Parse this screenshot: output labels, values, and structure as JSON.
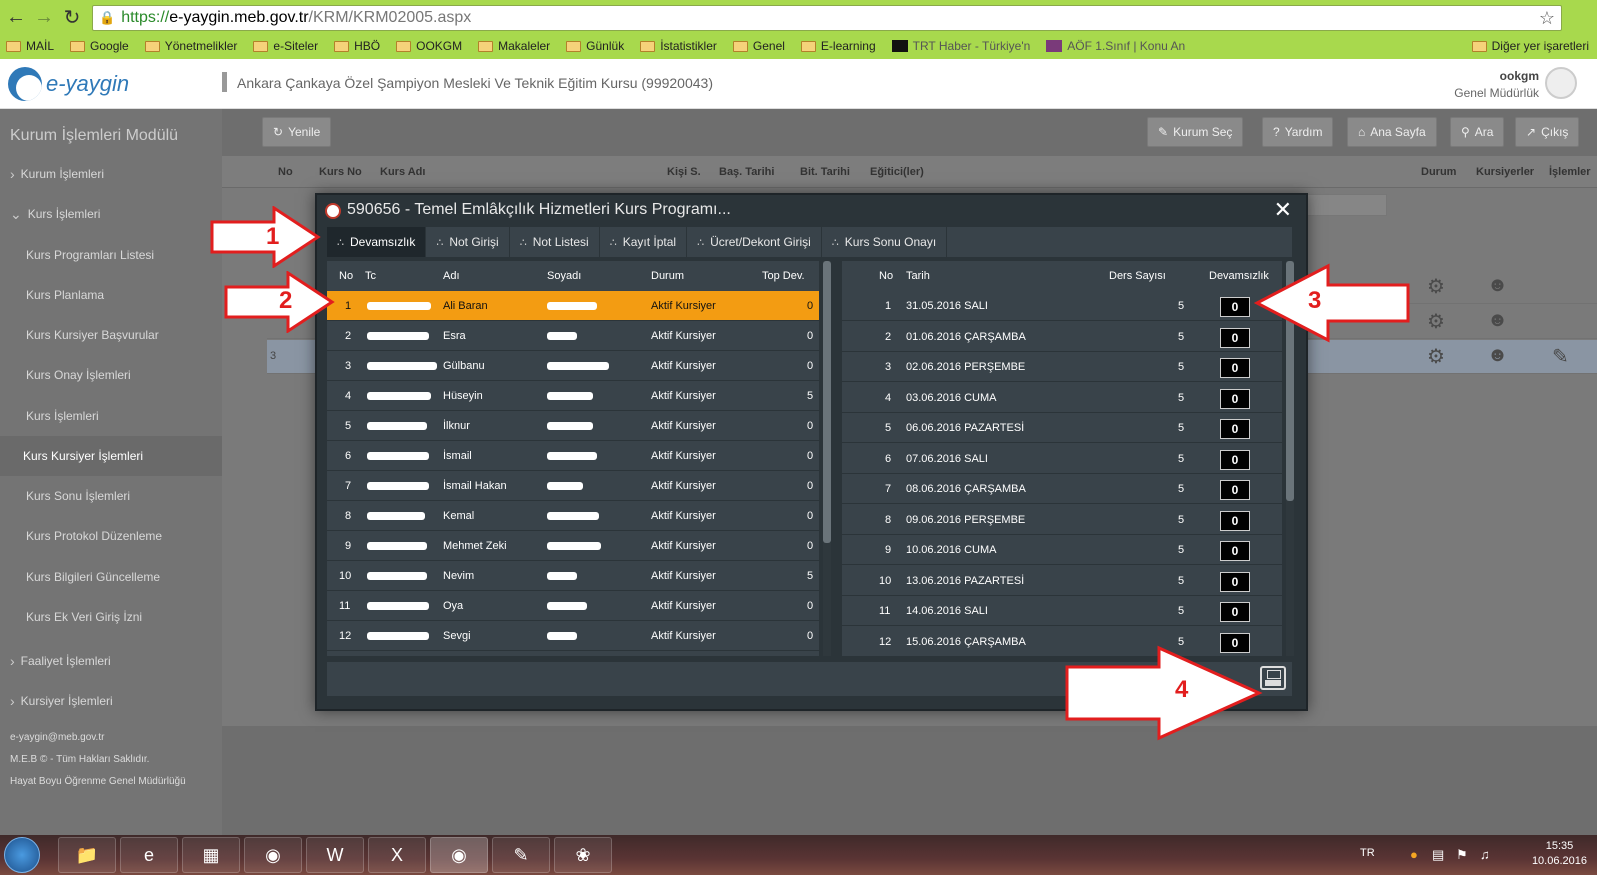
{
  "browser": {
    "url_scheme": "https://",
    "url_host": "e-yaygin.meb.gov.tr",
    "url_path": "/KRM/KRM02005.aspx",
    "bookmarks": [
      "MAİL",
      "Google",
      "Yönetmelikler",
      "e-Siteler",
      "HBÖ",
      "OOKGM",
      "Makaleler",
      "Günlük",
      "İstatistikler",
      "Genel",
      "E-learning"
    ],
    "bookmark_trt": "TRT Haber - Türkiye'n",
    "bookmark_aof": "AÖF 1.Sınıf | Konu An",
    "bookmark_other": "Diğer yer işaretleri"
  },
  "header": {
    "logo": "e-yaygin",
    "institution": "Ankara Çankaya Özel Şampiyon Mesleki Ve Teknik Eğitim Kursu (99920043)",
    "user_name": "ookgm",
    "user_dept": "Genel Müdürlük"
  },
  "sidebar": {
    "title": "Kurum İşlemleri Modülü",
    "items": [
      {
        "label": "Kurum İşlemleri",
        "kind": "cat"
      },
      {
        "label": "Kurs İşlemleri",
        "kind": "cat-open"
      },
      {
        "label": "Kurs Programları Listesi",
        "kind": "sub"
      },
      {
        "label": "Kurs Planlama",
        "kind": "sub"
      },
      {
        "label": "Kurs Kursiyer Başvurular",
        "kind": "sub"
      },
      {
        "label": "Kurs Onay İşlemleri",
        "kind": "sub"
      },
      {
        "label": "Kurs İşlemleri",
        "kind": "sub"
      },
      {
        "label": "Kurs Kursiyer İşlemleri",
        "kind": "active"
      },
      {
        "label": "Kurs Sonu İşlemleri",
        "kind": "sub"
      },
      {
        "label": "Kurs Protokol Düzenleme",
        "kind": "sub"
      },
      {
        "label": "Kurs Bilgileri Güncelleme",
        "kind": "sub"
      },
      {
        "label": "Kurs Ek Veri Giriş İzni",
        "kind": "sub"
      },
      {
        "label": "Faaliyet İşlemleri",
        "kind": "cat"
      },
      {
        "label": "Kursiyer İşlemleri",
        "kind": "cat"
      }
    ],
    "footer": [
      "e-yaygin@meb.gov.tr",
      "M.E.B © - Tüm Hakları Saklıdır.",
      "Hayat Boyu Öğrenme Genel Müdürlüğü"
    ]
  },
  "toolbar": {
    "refresh": "Yenile",
    "select_inst": "Kurum Seç",
    "help": "Yardım",
    "home": "Ana Sayfa",
    "search": "Ara",
    "logout": "Çıkış"
  },
  "grid": {
    "headers": [
      "No",
      "Kurs No",
      "Kurs Adı",
      "Kişi S.",
      "Baş. Tarihi",
      "Bit. Tarihi",
      "Eğitici(ler)",
      "Durum",
      "Kursiyerler",
      "İşlemler"
    ],
    "row3_no": "3"
  },
  "modal": {
    "title": "590656 - Temel Emlâkçılık Hizmetleri Kurs Programı...",
    "tabs": [
      "Devamsızlık",
      "Not Girişi",
      "Not Listesi",
      "Kayıt İptal",
      "Ücret/Dekont Girişi",
      "Kurs Sonu Onayı"
    ],
    "left_headers": [
      "No",
      "Tc",
      "Adı",
      "Soyadı",
      "Durum",
      "Top Dev."
    ],
    "students": [
      {
        "no": "1",
        "name": "Ali Baran",
        "status": "Aktif Kursiyer",
        "total": "0"
      },
      {
        "no": "2",
        "name": "Esra",
        "status": "Aktif Kursiyer",
        "total": "0"
      },
      {
        "no": "3",
        "name": "Gülbanu",
        "status": "Aktif Kursiyer",
        "total": "0"
      },
      {
        "no": "4",
        "name": "Hüseyin",
        "status": "Aktif Kursiyer",
        "total": "5"
      },
      {
        "no": "5",
        "name": "İlknur",
        "status": "Aktif Kursiyer",
        "total": "0"
      },
      {
        "no": "6",
        "name": "İsmail",
        "status": "Aktif Kursiyer",
        "total": "0"
      },
      {
        "no": "7",
        "name": "İsmail Hakan",
        "status": "Aktif Kursiyer",
        "total": "0"
      },
      {
        "no": "8",
        "name": "Kemal",
        "status": "Aktif Kursiyer",
        "total": "0"
      },
      {
        "no": "9",
        "name": "Mehmet Zeki",
        "status": "Aktif Kursiyer",
        "total": "0"
      },
      {
        "no": "10",
        "name": "Nevim",
        "status": "Aktif Kursiyer",
        "total": "5"
      },
      {
        "no": "11",
        "name": "Oya",
        "status": "Aktif Kursiyer",
        "total": "0"
      },
      {
        "no": "12",
        "name": "Sevgi",
        "status": "Aktif Kursiyer",
        "total": "0"
      }
    ],
    "right_headers": [
      "No",
      "Tarih",
      "Ders Sayısı",
      "Devamsızlık"
    ],
    "sessions": [
      {
        "no": "1",
        "date": "31.05.2016 SALI",
        "lessons": "5",
        "absence": "0"
      },
      {
        "no": "2",
        "date": "01.06.2016 ÇARŞAMBA",
        "lessons": "5",
        "absence": "0"
      },
      {
        "no": "3",
        "date": "02.06.2016 PERŞEMBE",
        "lessons": "5",
        "absence": "0"
      },
      {
        "no": "4",
        "date": "03.06.2016 CUMA",
        "lessons": "5",
        "absence": "0"
      },
      {
        "no": "5",
        "date": "06.06.2016 PAZARTESİ",
        "lessons": "5",
        "absence": "0"
      },
      {
        "no": "6",
        "date": "07.06.2016 SALI",
        "lessons": "5",
        "absence": "0"
      },
      {
        "no": "7",
        "date": "08.06.2016 ÇARŞAMBA",
        "lessons": "5",
        "absence": "0"
      },
      {
        "no": "8",
        "date": "09.06.2016 PERŞEMBE",
        "lessons": "5",
        "absence": "0"
      },
      {
        "no": "9",
        "date": "10.06.2016 CUMA",
        "lessons": "5",
        "absence": "0"
      },
      {
        "no": "10",
        "date": "13.06.2016 PAZARTESİ",
        "lessons": "5",
        "absence": "0"
      },
      {
        "no": "11",
        "date": "14.06.2016 SALI",
        "lessons": "5",
        "absence": "0"
      },
      {
        "no": "12",
        "date": "15.06.2016 ÇARŞAMBA",
        "lessons": "5",
        "absence": "0"
      }
    ]
  },
  "annotations": [
    "1",
    "2",
    "3",
    "4"
  ],
  "taskbar": {
    "lang": "TR",
    "time": "15:35",
    "date": "10.06.2016"
  },
  "colors": {
    "highlight": "#f39c12",
    "arrow_red": "#e21e1e",
    "chrome_green": "#a8d94d"
  }
}
